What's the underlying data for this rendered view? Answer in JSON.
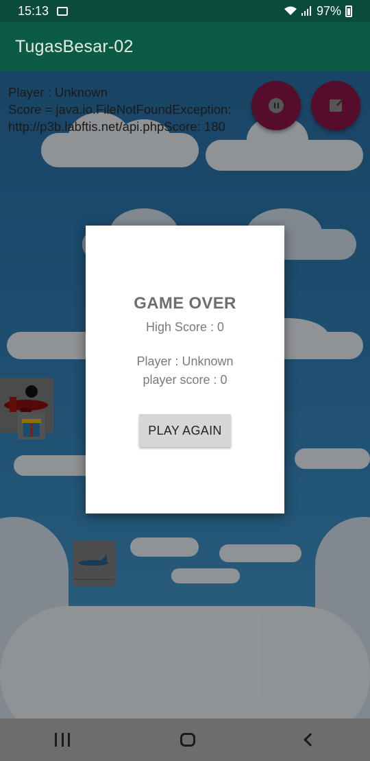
{
  "status_bar": {
    "time": "15:13",
    "battery_percent": "97%",
    "icons": [
      "image-icon",
      "wifi-icon",
      "signal-icon",
      "battery-icon"
    ]
  },
  "app_bar": {
    "title": "TugasBesar-02"
  },
  "hud": {
    "player_line": "Player : Unknown",
    "score_line_1": "Score = java.io.FileNotFoundException:",
    "score_line_2": "http://p3b.labftis.net/api.phpScore: 180"
  },
  "fabs": {
    "pause_icon": "pause-icon",
    "edit_icon": "edit-icon",
    "color": "#8a1546"
  },
  "dialog": {
    "title": "GAME OVER",
    "high_score": "High Score : 0",
    "player": "Player : Unknown",
    "player_score": "player score : 0",
    "button_label": "PLAY AGAIN"
  },
  "nav_bar": {
    "icons": [
      "recents-icon",
      "home-icon",
      "back-icon"
    ]
  },
  "colors": {
    "status_bar": "#0a4b3a",
    "app_bar": "#0b5b45",
    "dialog_bg": "#ffffff",
    "nav_bar": "#6d6d6d"
  }
}
